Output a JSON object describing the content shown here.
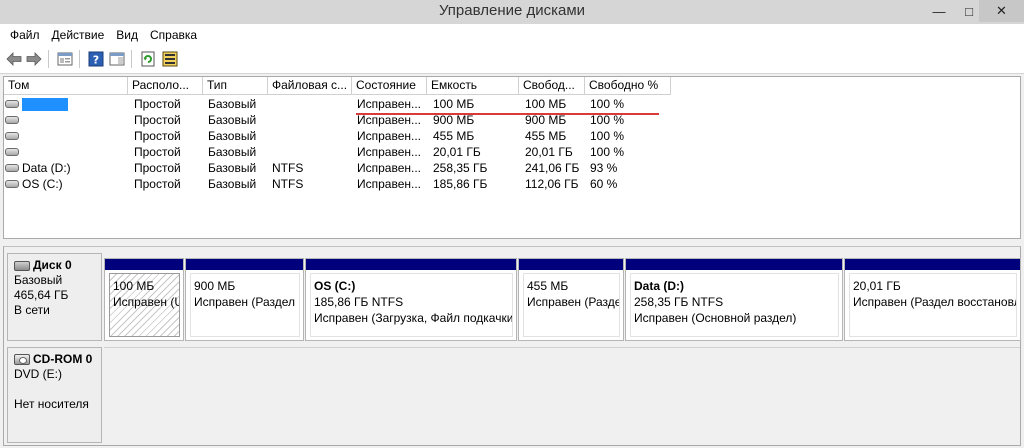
{
  "window": {
    "title": "Управление дисками",
    "minimize_glyph": "—",
    "maximize_glyph": "□",
    "close_glyph": "✕"
  },
  "menu": {
    "items": [
      {
        "label": "Файл"
      },
      {
        "label": "Действие"
      },
      {
        "label": "Вид"
      },
      {
        "label": "Справка"
      }
    ]
  },
  "toolbar": {
    "buttons": [
      "back-arrow-icon",
      "forward-arrow-icon",
      "console-tree-icon",
      "help-icon",
      "details-pane-icon",
      "refresh-icon",
      "properties-icon"
    ]
  },
  "volume_list": {
    "columns": [
      "Том",
      "Располо...",
      "Тип",
      "Файловая с...",
      "Состояние",
      "Емкость",
      "Свобод...",
      "Свободно %"
    ],
    "rows": [
      {
        "name": "",
        "redacted": true,
        "layout": "Простой",
        "type": "Базовый",
        "fs": "",
        "status": "Исправен...",
        "capacity": "100 МБ",
        "free": "100 МБ",
        "free_pct": "100 %"
      },
      {
        "name": "",
        "redacted": false,
        "layout": "Простой",
        "type": "Базовый",
        "fs": "",
        "status": "Исправен...",
        "capacity": "900 МБ",
        "free": "900 МБ",
        "free_pct": "100 %"
      },
      {
        "name": "",
        "redacted": false,
        "layout": "Простой",
        "type": "Базовый",
        "fs": "",
        "status": "Исправен...",
        "capacity": "455 МБ",
        "free": "455 МБ",
        "free_pct": "100 %"
      },
      {
        "name": "",
        "redacted": false,
        "layout": "Простой",
        "type": "Базовый",
        "fs": "",
        "status": "Исправен...",
        "capacity": "20,01 ГБ",
        "free": "20,01 ГБ",
        "free_pct": "100 %"
      },
      {
        "name": "Data (D:)",
        "redacted": false,
        "layout": "Простой",
        "type": "Базовый",
        "fs": "NTFS",
        "status": "Исправен...",
        "capacity": "258,35 ГБ",
        "free": "241,06 ГБ",
        "free_pct": "93 %"
      },
      {
        "name": "OS (C:)",
        "redacted": false,
        "layout": "Простой",
        "type": "Базовый",
        "fs": "NTFS",
        "status": "Исправен...",
        "capacity": "185,86 ГБ",
        "free": "112,06 ГБ",
        "free_pct": "60 %"
      }
    ]
  },
  "disk0": {
    "name": "Диск 0",
    "type": "Базовый",
    "size": "465,64 ГБ",
    "state": "В сети",
    "partitions": [
      {
        "name": "",
        "size": "100 МБ",
        "status": "Исправен (U",
        "selected": true
      },
      {
        "name": "",
        "size": "900 МБ",
        "status": "Исправен (Раздел в",
        "selected": false
      },
      {
        "name": "OS  (C:)",
        "size": "185,86 ГБ NTFS",
        "status": "Исправен (Загрузка, Файл подкачки,",
        "selected": false
      },
      {
        "name": "",
        "size": "455 МБ",
        "status": "Исправен (Разде",
        "selected": false
      },
      {
        "name": "Data  (D:)",
        "size": "258,35 ГБ NTFS",
        "status": "Исправен (Основной раздел)",
        "selected": false
      },
      {
        "name": "",
        "size": "20,01 ГБ",
        "status": "Исправен (Раздел восстановле",
        "selected": false
      }
    ]
  },
  "cdrom0": {
    "name": "CD-ROM 0",
    "drive": "DVD (E:)",
    "state": "Нет носителя"
  },
  "colors": {
    "partition_bar": "#00007d",
    "highlight_line": "#d93b3b",
    "redaction": "#1e90ff"
  }
}
